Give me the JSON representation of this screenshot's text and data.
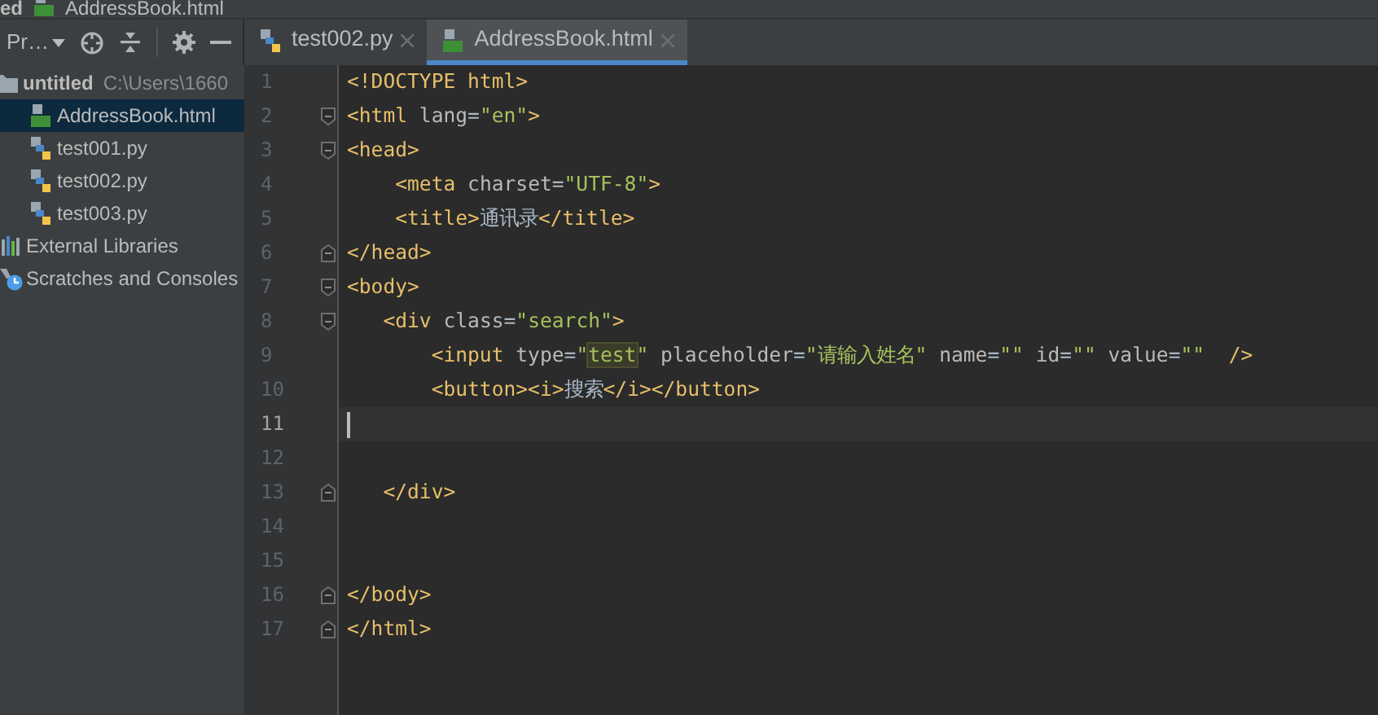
{
  "breadcrumb": [
    {
      "text": "ed",
      "kind": "folder"
    },
    {
      "text": "AddressBook.html",
      "kind": "html"
    }
  ],
  "project_toolbar": {
    "label": "Pr…"
  },
  "tabs": [
    {
      "label": "test002.py",
      "kind": "python",
      "selected": false
    },
    {
      "label": "AddressBook.html",
      "kind": "html",
      "selected": true
    }
  ],
  "project_tree": [
    {
      "label": "untitled",
      "path": "C:\\Users\\1660",
      "kind": "folder",
      "selected": false,
      "children": [
        {
          "label": "AddressBook.html",
          "kind": "html",
          "selected": true
        },
        {
          "label": "test001.py",
          "kind": "python",
          "selected": false
        },
        {
          "label": "test002.py",
          "kind": "python",
          "selected": false
        },
        {
          "label": "test003.py",
          "kind": "python",
          "selected": false
        }
      ]
    },
    {
      "label": "External Libraries",
      "kind": "libraries",
      "selected": false
    },
    {
      "label": "Scratches and Consoles",
      "kind": "scratches",
      "selected": false
    }
  ],
  "editor": {
    "lines": [
      {
        "number": "1",
        "fold_start": false,
        "fold_end": false,
        "current": false,
        "segments": [
          {
            "kind": "tag",
            "text": "<!DOCTYPE html>"
          }
        ]
      },
      {
        "number": "2",
        "fold_start": true,
        "fold_end": false,
        "current": false,
        "segments": [
          {
            "kind": "tag",
            "text": "<html "
          },
          {
            "kind": "attr",
            "text": "lang"
          },
          {
            "kind": "plain",
            "text": "="
          },
          {
            "kind": "value",
            "text": "\"en\""
          },
          {
            "kind": "tag",
            "text": ">"
          }
        ]
      },
      {
        "number": "3",
        "fold_start": true,
        "fold_end": false,
        "current": false,
        "segments": [
          {
            "kind": "tag",
            "text": "<head>"
          }
        ]
      },
      {
        "number": "4",
        "fold_start": false,
        "fold_end": false,
        "current": false,
        "segments": [
          {
            "kind": "tag",
            "text": "    <meta "
          },
          {
            "kind": "attr",
            "text": "charset"
          },
          {
            "kind": "plain",
            "text": "="
          },
          {
            "kind": "value",
            "text": "\"UTF-8\""
          },
          {
            "kind": "tag",
            "text": ">"
          }
        ]
      },
      {
        "number": "5",
        "fold_start": false,
        "fold_end": false,
        "current": false,
        "segments": [
          {
            "kind": "tag",
            "text": "    <title>"
          },
          {
            "kind": "text",
            "text": "通讯录"
          },
          {
            "kind": "tag",
            "text": "</title>"
          }
        ]
      },
      {
        "number": "6",
        "fold_start": false,
        "fold_end": true,
        "current": false,
        "segments": [
          {
            "kind": "tag",
            "text": "</head>"
          }
        ]
      },
      {
        "number": "7",
        "fold_start": true,
        "fold_end": false,
        "current": false,
        "segments": [
          {
            "kind": "tag",
            "text": "<body>"
          }
        ]
      },
      {
        "number": "8",
        "fold_start": true,
        "fold_end": false,
        "current": false,
        "segments": [
          {
            "kind": "tag",
            "text": "   <div "
          },
          {
            "kind": "attr",
            "text": "class"
          },
          {
            "kind": "plain",
            "text": "="
          },
          {
            "kind": "value",
            "text": "\"search\""
          },
          {
            "kind": "tag",
            "text": ">"
          }
        ]
      },
      {
        "number": "9",
        "fold_start": false,
        "fold_end": false,
        "current": false,
        "segments": [
          {
            "kind": "tag",
            "text": "       <input "
          },
          {
            "kind": "attr",
            "text": "type"
          },
          {
            "kind": "plain",
            "text": "="
          },
          {
            "kind": "value",
            "text": "\""
          },
          {
            "kind": "highlight",
            "text": "test"
          },
          {
            "kind": "value",
            "text": "\" "
          },
          {
            "kind": "attr",
            "text": "placeholder"
          },
          {
            "kind": "plain",
            "text": "="
          },
          {
            "kind": "value",
            "text": "\"请输入姓名\" "
          },
          {
            "kind": "attr",
            "text": "name"
          },
          {
            "kind": "plain",
            "text": "="
          },
          {
            "kind": "value",
            "text": "\"\" "
          },
          {
            "kind": "attr",
            "text": "id"
          },
          {
            "kind": "plain",
            "text": "="
          },
          {
            "kind": "value",
            "text": "\"\" "
          },
          {
            "kind": "attr",
            "text": "value"
          },
          {
            "kind": "plain",
            "text": "="
          },
          {
            "kind": "value",
            "text": "\"\"  "
          },
          {
            "kind": "tag",
            "text": "/>"
          }
        ]
      },
      {
        "number": "10",
        "fold_start": false,
        "fold_end": false,
        "current": false,
        "segments": [
          {
            "kind": "tag",
            "text": "       <button><i>"
          },
          {
            "kind": "text",
            "text": "搜索"
          },
          {
            "kind": "tag",
            "text": "</i></button>"
          }
        ]
      },
      {
        "number": "11",
        "fold_start": false,
        "fold_end": false,
        "current": true
      },
      {
        "number": "12",
        "fold_start": false,
        "fold_end": false,
        "current": false
      },
      {
        "number": "13",
        "fold_start": false,
        "fold_end": true,
        "current": false,
        "segments": [
          {
            "kind": "tag",
            "text": "   </div>"
          }
        ]
      },
      {
        "number": "14",
        "fold_start": false,
        "fold_end": false,
        "current": false
      },
      {
        "number": "15",
        "fold_start": false,
        "fold_end": false,
        "current": false
      },
      {
        "number": "16",
        "fold_start": false,
        "fold_end": true,
        "current": false,
        "segments": [
          {
            "kind": "tag",
            "text": "</body>"
          }
        ]
      },
      {
        "number": "17",
        "fold_start": false,
        "fold_end": true,
        "current": false,
        "segments": [
          {
            "kind": "tag",
            "text": "</html>"
          }
        ]
      }
    ]
  }
}
